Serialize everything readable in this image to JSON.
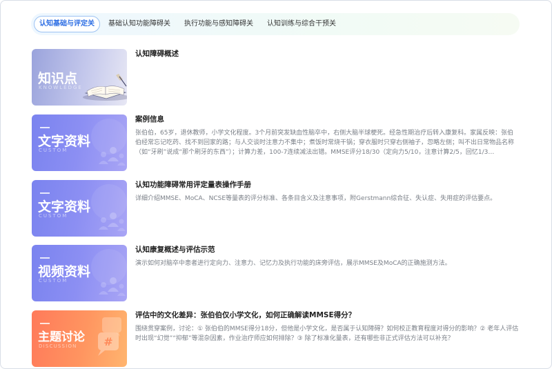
{
  "tabs": [
    {
      "label": "认知基础与评定关",
      "active": true
    },
    {
      "label": "基础认知功能障碍关",
      "active": false
    },
    {
      "label": "执行功能与感知障碍关",
      "active": false
    },
    {
      "label": "认知训练与综合干预关",
      "active": false
    }
  ],
  "items": [
    {
      "thumb": {
        "kind": "knowledge",
        "big": "知识点",
        "sub": "KNOWLEDGE"
      },
      "title": "认知障碍概述",
      "desc": ""
    },
    {
      "thumb": {
        "kind": "document",
        "big": "文字资料",
        "sub": "CUSTOM"
      },
      "title": "案例信息",
      "desc": "张伯伯，65岁，退休教师，小学文化程度。3个月前突发缺血性脑卒中，右侧大脑半球梗死。经急性期治疗后转入康复科。家属反映：张伯伯经常忘记吃药、找不到回家的路；与人交谈时注意力不集中；煮饭时常烧干锅；穿衣服时只穿右侧袖子，忽略左侧；叫不出日常物品名称（如“牙刷”说成“那个刷牙的东西”）；计算力差，100-7连续减法出错。MMSE评分18/30（定向力5/10，注意计算2/5，回忆1/3…"
    },
    {
      "thumb": {
        "kind": "document",
        "big": "文字资料",
        "sub": "CUSTOM"
      },
      "title": "认知功能障碍常用评定量表操作手册",
      "desc": "详细介绍MMSE、MoCA、NCSE等量表的评分标准、各条目含义及注意事项，附Gerstmann综合征、失认症、失用症的评估要点。"
    },
    {
      "thumb": {
        "kind": "video",
        "big": "视频资料",
        "sub": "CUSTOM"
      },
      "title": "认知康复概述与评估示范",
      "desc": "演示如何对脑卒中患者进行定向力、注意力、记忆力及执行功能的床旁评估，展示MMSE及MoCA的正确施测方法。"
    },
    {
      "thumb": {
        "kind": "discussion",
        "big": "主题讨论",
        "sub": "DISCUSSION"
      },
      "title": "评估中的文化差异：张伯伯仅小学文化，如何正确解读MMSE得分？",
      "desc": "围绕贯穿案例，讨论：① 张伯伯的MMSE得分18分，但他是小学文化，是否属于认知障碍？如何校正教育程度对得分的影响？② 老年人评估时出现“幻觉”“抑郁”等混杂因素，作业治疗师应如何排除？③ 除了标准化量表，还有哪些非正式评估方法可以补充？"
    }
  ]
}
